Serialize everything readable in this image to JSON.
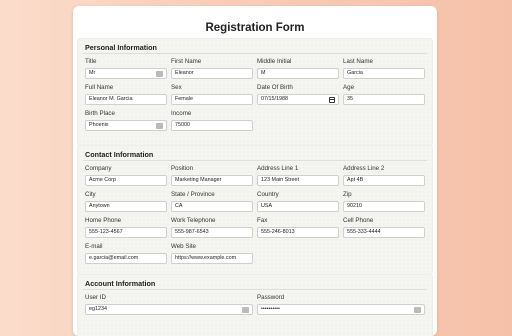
{
  "form": {
    "title": "Registration Form"
  },
  "personal": {
    "heading": "Personal Information",
    "title": {
      "label": "Title",
      "value": "Mr"
    },
    "first_name": {
      "label": "First Name",
      "value": "Eleanor"
    },
    "middle_initial": {
      "label": "Middle Initial",
      "value": "M"
    },
    "last_name": {
      "label": "Last Name",
      "value": "Garcia"
    },
    "full_name": {
      "label": "Full Name",
      "value": "Eleanor M. Garcia"
    },
    "sex": {
      "label": "Sex",
      "value": "Female"
    },
    "dob": {
      "label": "Date Of Birth",
      "value": "07/15/1988"
    },
    "age": {
      "label": "Age",
      "value": "35"
    },
    "birth_place": {
      "label": "Birth Place",
      "value": "Phoenix"
    },
    "income": {
      "label": "Income",
      "value": "75000"
    }
  },
  "contact": {
    "heading": "Contact Information",
    "company": {
      "label": "Company",
      "value": "Acme Corp"
    },
    "position": {
      "label": "Position",
      "value": "Marketing Manager"
    },
    "address1": {
      "label": "Address Line 1",
      "value": "123 Main Street"
    },
    "address2": {
      "label": "Address Line 2",
      "value": "Apt 4B"
    },
    "city": {
      "label": "City",
      "value": "Anytown"
    },
    "state": {
      "label": "State / Province",
      "value": "CA"
    },
    "country": {
      "label": "Country",
      "value": "USA"
    },
    "zip": {
      "label": "Zip",
      "value": "90210"
    },
    "home_phone": {
      "label": "Home Phone",
      "value": "555-123-4567"
    },
    "work_phone": {
      "label": "Work Telephone",
      "value": "555-987-6543"
    },
    "fax": {
      "label": "Fax",
      "value": "555-246-8013"
    },
    "cell_phone": {
      "label": "Cell Phone",
      "value": "555-333-4444"
    },
    "email": {
      "label": "E-mail",
      "value": "e.garcia@email.com"
    },
    "website": {
      "label": "Web Site",
      "value": "https://www.example.com"
    }
  },
  "account": {
    "heading": "Account Information",
    "user_id": {
      "label": "User ID",
      "value": "eg1234"
    },
    "password": {
      "label": "Password",
      "value": "••••••••••"
    }
  }
}
